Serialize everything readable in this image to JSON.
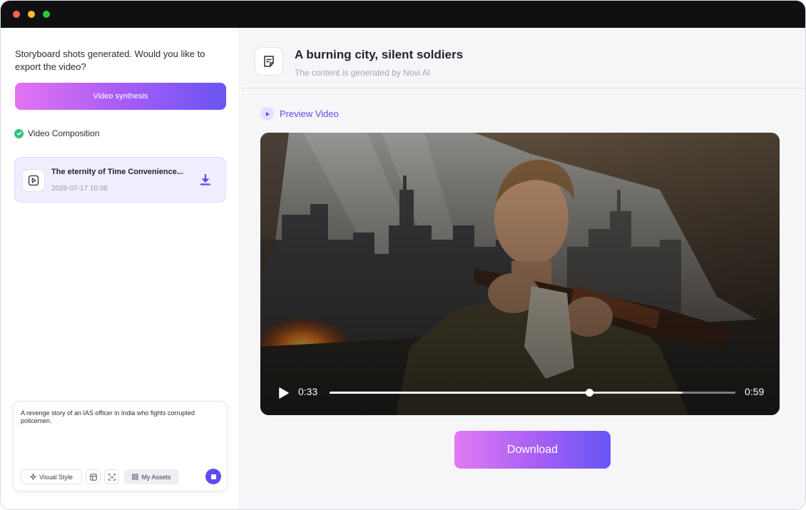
{
  "left_panel": {
    "prompt_message": "Storyboard shots generated. Would you like to export the video?",
    "synthesis_button_label": "Video synthesis",
    "composition_label": "Video Composition",
    "video_card": {
      "title": "The eternity of Time Convenience...",
      "date": "2026-07-17 10:06"
    },
    "composer": {
      "text": "A revenge story of an IAS officer in India who fights corrupted policemen.",
      "tools": {
        "visual_style_label": "Visual Style",
        "my_assets_label": "My Assets"
      }
    }
  },
  "header": {
    "title": "A burning city, silent soldiers",
    "subtitle": "The content is generated by Novi AI"
  },
  "preview": {
    "label": "Preview Video",
    "current_time": "0:33",
    "total_time": "0:59",
    "progress_fraction": 0.64,
    "buffered_fraction": 0.87
  },
  "download_button_label": "Download",
  "colors": {
    "accent": "#5b4cf0",
    "gradient_start": "#e373f2",
    "gradient_end": "#6a55f4",
    "success": "#34c07a"
  }
}
